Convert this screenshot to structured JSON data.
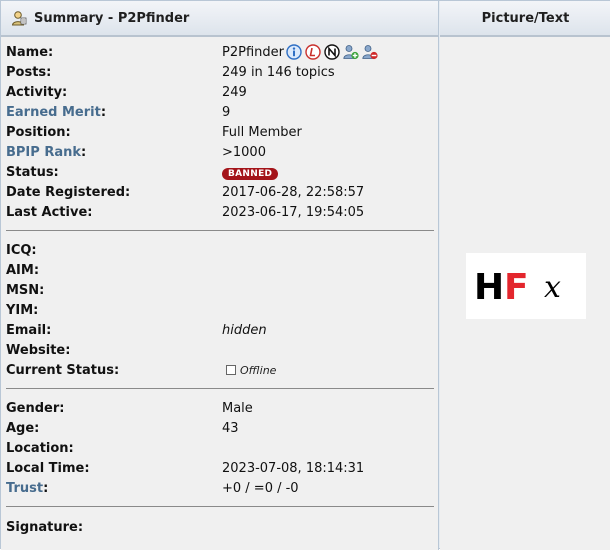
{
  "header": {
    "summary_title": "Summary - P2Pfinder",
    "picture_title": "Picture/Text"
  },
  "profile": {
    "name_label": "Name:",
    "name": "P2Pfinder",
    "posts_label": "Posts:",
    "posts": "249 in 146 topics",
    "activity_label": "Activity:",
    "activity": "249",
    "merit_label": "Earned Merit",
    "merit_colon": ":",
    "merit": "9",
    "position_label": "Position:",
    "position": "Full Member",
    "bpip_label": "BPIP Rank",
    "bpip_colon": ":",
    "bpip": ">1000",
    "status_label": "Status:",
    "status": "BANNED",
    "registered_label": "Date Registered:",
    "registered": "2017-06-28, 22:58:57",
    "last_active_label": "Last Active:",
    "last_active": "2023-06-17, 19:54:05"
  },
  "contact": {
    "icq_label": "ICQ:",
    "aim_label": "AIM:",
    "msn_label": "MSN:",
    "yim_label": "YIM:",
    "email_label": "Email:",
    "email": "hidden",
    "website_label": "Website:",
    "current_status_label": "Current Status:",
    "current_status": "Offline"
  },
  "personal": {
    "gender_label": "Gender:",
    "gender": "Male",
    "age_label": "Age:",
    "age": "43",
    "location_label": "Location:",
    "local_time_label": "Local Time:",
    "local_time": "2023-07-08, 18:14:31",
    "trust_label": "Trust",
    "trust_colon": ":",
    "trust": "+0 / =0 / -0"
  },
  "signature_label": "Signature:",
  "avatar": {
    "text_h": "H",
    "text_f": "F",
    "text_x": "x"
  },
  "icons": [
    "info-icon",
    "ignore-icon",
    "newbie-icon",
    "add-friend-icon",
    "remove-friend-icon",
    "user-icon"
  ],
  "colors": {
    "link": "#476c8e",
    "badge": "#a4141a",
    "header_bg": "#e1e7ee"
  }
}
